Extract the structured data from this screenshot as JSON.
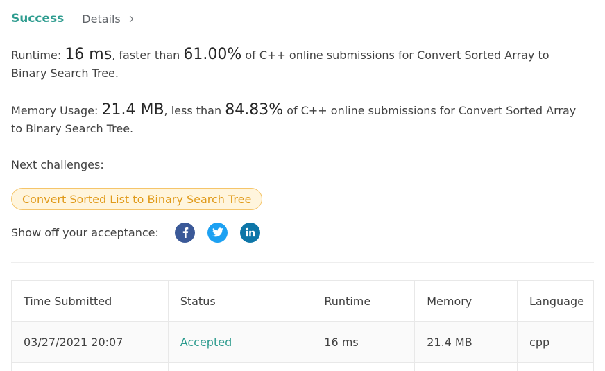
{
  "header": {
    "status_title": "Success",
    "details_label": "Details"
  },
  "runtime": {
    "label": "Runtime: ",
    "value": "16 ms",
    "middle": ", faster than ",
    "percent": "61.00%",
    "suffix": " of C++ online submissions for Convert Sorted Array to Binary Search Tree."
  },
  "memory": {
    "label": "Memory Usage: ",
    "value": "21.4 MB",
    "middle": ", less than ",
    "percent": "84.83%",
    "suffix": " of C++ online submissions for Convert Sorted Array to Binary Search Tree."
  },
  "next": {
    "label": "Next challenges:",
    "challenges": [
      "Convert Sorted List to Binary Search Tree"
    ]
  },
  "share": {
    "label": "Show off your acceptance:",
    "icons": [
      {
        "name": "facebook-icon",
        "glyph": "f",
        "color": "#3b5998"
      },
      {
        "name": "twitter-icon",
        "glyph": "twitter",
        "color": "#1da1f2"
      },
      {
        "name": "linkedin-icon",
        "glyph": "in",
        "color": "#0e76a8"
      }
    ]
  },
  "table": {
    "headers": [
      "Time Submitted",
      "Status",
      "Runtime",
      "Memory",
      "Language"
    ],
    "rows": [
      {
        "time": "03/27/2021 20:07",
        "status": "Accepted",
        "runtime": "16 ms",
        "memory": "21.4 MB",
        "language": "cpp"
      }
    ]
  },
  "colors": {
    "accent": "#2e9c8f",
    "challenge_text": "#e09a1a",
    "challenge_bg": "#fff5dd",
    "challenge_border": "#f5c56a"
  }
}
